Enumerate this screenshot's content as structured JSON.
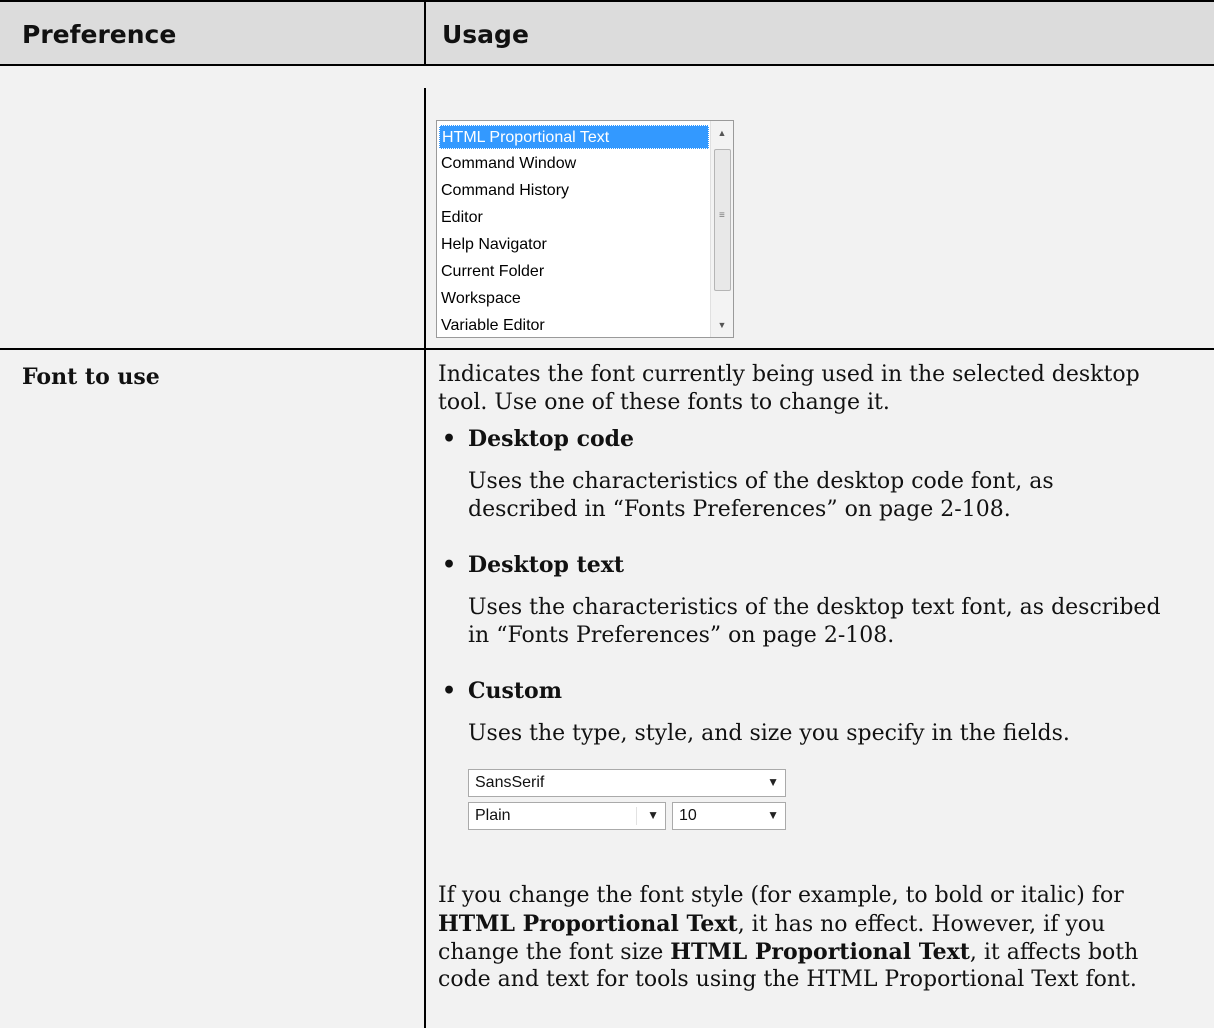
{
  "table": {
    "header": {
      "preference": "Preference",
      "usage": "Usage"
    }
  },
  "font_list": {
    "items": [
      "HTML Proportional Text",
      "Command Window",
      "Command History",
      "Editor",
      "Help Navigator",
      "Current Folder",
      "Workspace",
      "Variable Editor"
    ],
    "selected": "HTML Proportional Text"
  },
  "font_to_use": {
    "label": "Font to use",
    "intro_1": "Indicates the font currently being used in the selected desktop",
    "intro_2": "tool. Use one of these fonts to change it.",
    "options": [
      {
        "title": "Desktop code",
        "desc_1": "Uses the characteristics of the desktop code font, as",
        "desc_2": "described in “Fonts Preferences” on page 2-108."
      },
      {
        "title": "Desktop text",
        "desc_1": "Uses the characteristics of the desktop text font, as described",
        "desc_2": "in “Fonts Preferences” on page 2-108."
      },
      {
        "title": "Custom",
        "desc_1": "Uses the type, style, and size you specify in the fields."
      }
    ],
    "custom_fields": {
      "type": "SansSerif",
      "style": "Plain",
      "size": "10"
    },
    "note_1a": "If you change the font style (for example, to bold or italic) for",
    "note_2a": "HTML Proportional Text",
    "note_2b": ", it has no effect. However, if you",
    "note_3a": "change the font size ",
    "note_3b": "HTML Proportional Text",
    "note_3c": ", it affects both",
    "note_4": "code and text for tools using the HTML Proportional Text font."
  }
}
